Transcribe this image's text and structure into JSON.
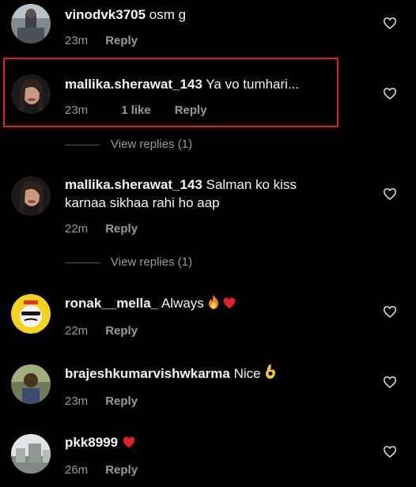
{
  "comments": [
    {
      "username": "vinodvk3705",
      "text": "osm g",
      "time": "23m",
      "likes": "",
      "reply": "Reply"
    },
    {
      "username": "mallika.sherawat_143",
      "text": "Ya vo tumhari...",
      "time": "23m",
      "likes": "1 like",
      "reply": "Reply"
    },
    {
      "username": "mallika.sherawat_143",
      "text_line1": "Salman ko kiss",
      "text_line2": "karnaa sikhaa rahi ho aap",
      "time": "22m",
      "reply": "Reply"
    },
    {
      "username": "ronak__mella_",
      "text": "Always",
      "time": "22m",
      "reply": "Reply"
    },
    {
      "username": "brajeshkumarvishwkarma",
      "text": "Nice",
      "time": "23m",
      "reply": "Reply"
    },
    {
      "username": "pkk8999",
      "text": "",
      "time": "26m",
      "reply": "Reply"
    }
  ],
  "view_replies": [
    "View replies (1)",
    "View replies (1)"
  ],
  "icons": {
    "like": "heart-outline-icon",
    "fire": "fire-emoji",
    "red_heart": "red-heart-emoji",
    "ok_hand": "ok-hand-emoji"
  },
  "colors": {
    "highlight": "#e0221b",
    "muted": "#9a9a9a",
    "background": "#000000"
  }
}
